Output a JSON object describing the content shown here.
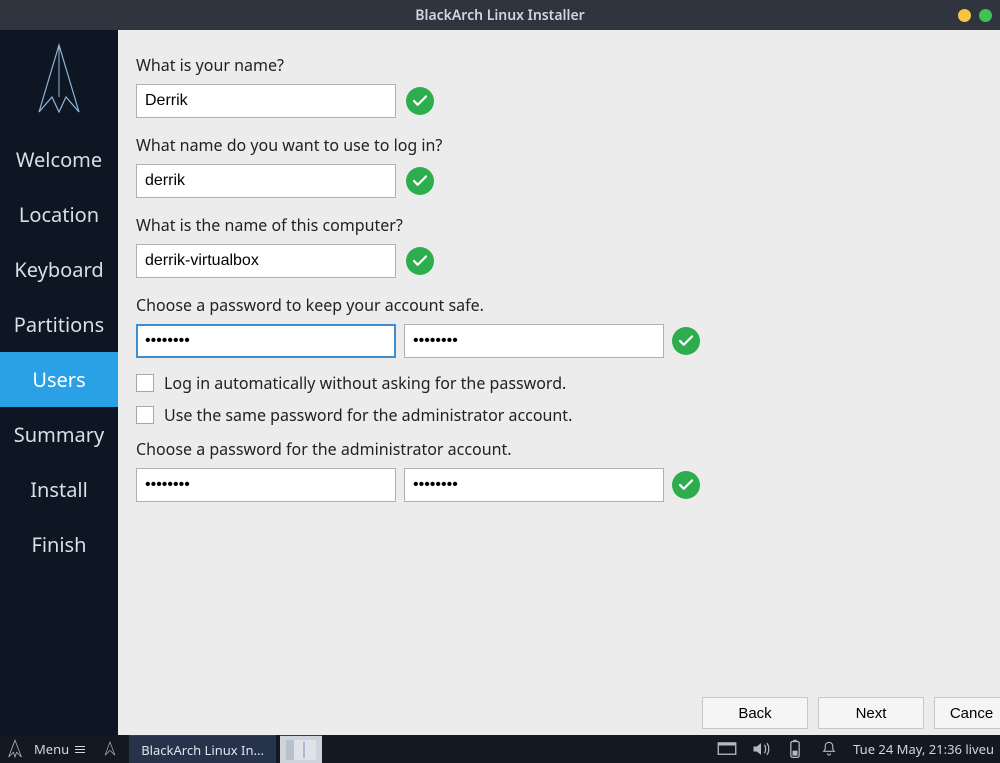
{
  "window": {
    "title": "BlackArch Linux Installer"
  },
  "sidebar": {
    "items": [
      {
        "label": "Welcome",
        "active": false
      },
      {
        "label": "Location",
        "active": false
      },
      {
        "label": "Keyboard",
        "active": false
      },
      {
        "label": "Partitions",
        "active": false
      },
      {
        "label": "Users",
        "active": true
      },
      {
        "label": "Summary",
        "active": false
      },
      {
        "label": "Install",
        "active": false
      },
      {
        "label": "Finish",
        "active": false
      }
    ]
  },
  "form": {
    "name_label": "What is your name?",
    "name_value": "Derrik",
    "login_label": "What name do you want to use to log in?",
    "login_value": "derrik",
    "host_label": "What is the name of this computer?",
    "host_value": "derrik-virtualbox",
    "pw_label": "Choose a password to keep your account safe.",
    "pw_value": "••••••••",
    "pw_confirm_value": "••••••••",
    "autologin_label": "Log in automatically without asking for the password.",
    "autologin_checked": false,
    "samepw_label": "Use the same password for the administrator account.",
    "samepw_checked": false,
    "admin_pw_label": "Choose a password for the administrator account.",
    "admin_pw_value": "••••••••",
    "admin_pw_confirm_value": "••••••••"
  },
  "buttons": {
    "back": "Back",
    "next": "Next",
    "cancel": "Cance"
  },
  "taskbar": {
    "menu_label": "Menu",
    "app_tile": "BlackArch Linux In...",
    "clock": "Tue 24 May, 21:36  liveu"
  },
  "icons": {
    "checkmark": "check-circle-icon",
    "logo": "blackarch-logo",
    "desktop": "show-desktop-icon",
    "volume": "volume-icon",
    "battery": "battery-icon",
    "notifications": "bell-icon",
    "hamburger": "menu-lines-icon"
  }
}
